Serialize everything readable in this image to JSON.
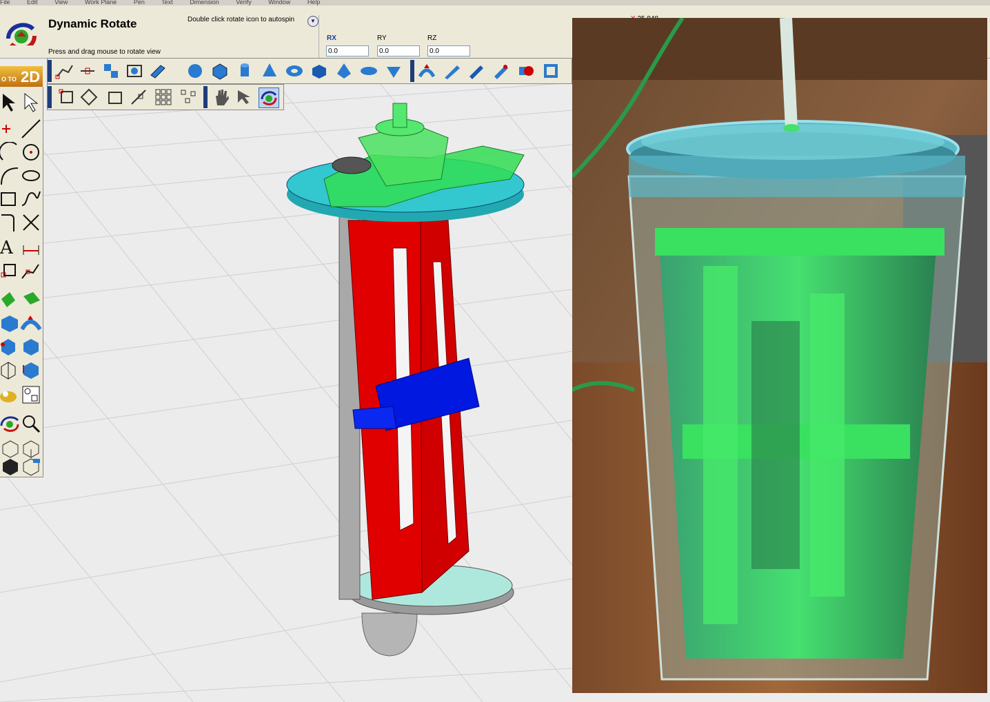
{
  "menu": {
    "items": [
      "File",
      "Edit",
      "View",
      "Work Plane",
      "Pen",
      "Text",
      "Dimension",
      "Verify",
      "Window",
      "Help"
    ]
  },
  "tool": {
    "title": "Dynamic Rotate",
    "hint": "Press and drag mouse to rotate view",
    "autospin_hint": "Double click rotate icon to autospin",
    "autospin_button": "▼"
  },
  "rotation": {
    "rx_label": "RX",
    "ry_label": "RY",
    "rz_label": "RZ",
    "rx": "0.0",
    "ry": "0.0",
    "rz": "0.0"
  },
  "status": {
    "x_label": "X",
    "x_value": "25.848"
  },
  "goto2d": {
    "prefix": "O TO",
    "label": "2D"
  },
  "icons": {
    "toolbar_top": [
      "snap-icon",
      "snap-midpoint-icon",
      "move-icon",
      "screen-icon",
      "extrude-icon",
      "sphere-icon",
      "box-icon",
      "cylinder-icon",
      "cone-icon",
      "torus-icon",
      "block-icon",
      "pyramid-icon",
      "ellipsoid-icon",
      "wedge-icon",
      "loft-icon",
      "sweep-icon",
      "bar-icon",
      "chamfer-icon",
      "boolean-icon",
      "shell-icon"
    ],
    "toolbar_second": [
      "select-box-icon",
      "rotate-shape-icon",
      "rectangle-icon",
      "pattern-icon",
      "grid-icon",
      "scatter-icon",
      "pan-hand-icon",
      "move-view-icon",
      "dynamic-rotate-icon"
    ],
    "sidebar": [
      "pointer-icon",
      "select-arrow-icon",
      "point-icon",
      "line-icon",
      "arc-icon",
      "circle-icon",
      "curve-icon",
      "ellipse-icon",
      "rectangle-icon",
      "spline-icon",
      "fillet-icon",
      "trim-icon",
      "text-icon",
      "dimension-icon",
      "box-select-icon",
      "node-icon",
      "surface-icon",
      "revolve-icon",
      "solid-icon",
      "sweep-solid-icon",
      "cube-icon",
      "edit-solid-icon",
      "wireframe-icon",
      "section-icon",
      "light-icon",
      "view-icon",
      "rotate-view-icon",
      "zoom-icon",
      "iso-view-icon",
      "iso-view-alt-icon",
      "shade-icon",
      "render-icon"
    ]
  },
  "colors": {
    "accent_blue": "#1f3d7a",
    "cad_red": "#e00000",
    "cad_green": "#33dd55",
    "cad_cyan": "#33c8d0",
    "cad_blue": "#0018e0"
  }
}
